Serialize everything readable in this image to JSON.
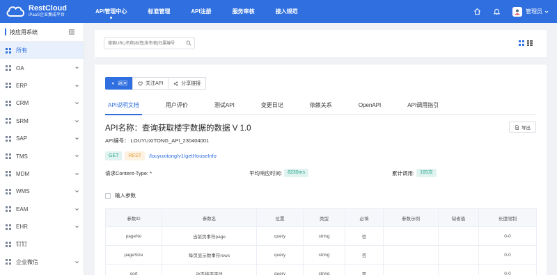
{
  "brand": {
    "name": "RestCloud",
    "subtitle": "iPaaS企业集成平台"
  },
  "nav": {
    "items": [
      {
        "label": "API管理中心",
        "active": true
      },
      {
        "label": "标准管理",
        "active": false
      },
      {
        "label": "API注册",
        "active": false
      },
      {
        "label": "服务审核",
        "active": false
      },
      {
        "label": "接入规范",
        "active": false
      }
    ]
  },
  "user": {
    "name": "管理员"
  },
  "sidebar": {
    "title": "按应用系统",
    "items": [
      {
        "label": "所有",
        "active": true,
        "expandable": false
      },
      {
        "label": "OA",
        "active": false,
        "expandable": true
      },
      {
        "label": "ERP",
        "active": false,
        "expandable": true
      },
      {
        "label": "CRM",
        "active": false,
        "expandable": true
      },
      {
        "label": "SRM",
        "active": false,
        "expandable": true
      },
      {
        "label": "SAP",
        "active": false,
        "expandable": true
      },
      {
        "label": "TMS",
        "active": false,
        "expandable": true
      },
      {
        "label": "MDM",
        "active": false,
        "expandable": true
      },
      {
        "label": "WMS",
        "active": false,
        "expandable": true
      },
      {
        "label": "EAM",
        "active": false,
        "expandable": true
      },
      {
        "label": "EHR",
        "active": false,
        "expandable": true
      },
      {
        "label": "钉钉",
        "active": false,
        "expandable": false
      },
      {
        "label": "企业微信",
        "active": false,
        "expandable": true
      }
    ]
  },
  "search": {
    "placeholder": "搜索URL|名称|标签|发布者|归属编号"
  },
  "actions": {
    "back": "返回",
    "follow": "关注API",
    "share": "分享链接"
  },
  "tabs": [
    {
      "label": "API说明文档",
      "active": true
    },
    {
      "label": "用户评价",
      "active": false
    },
    {
      "label": "测试API",
      "active": false
    },
    {
      "label": "变更日记",
      "active": false
    },
    {
      "label": "依赖关系",
      "active": false
    },
    {
      "label": "OpenAPI",
      "active": false
    },
    {
      "label": "API调用指引",
      "active": false
    }
  ],
  "api": {
    "title": "API名称：查询获取楼宇数据的数据 V 1.0",
    "export_label": "导出",
    "id_line": "API编号：  LOUYUXITONG_API_230404001",
    "method": "GET",
    "style": "REST",
    "path": "/louyuxitong/v1/getHouseInfo",
    "content_type_label": "请求Content-Type:  *",
    "avg_time_label": "平均响应时间:",
    "avg_time_value": "8230ms",
    "calls_label": "累计调用:",
    "calls_value": "165次"
  },
  "params": {
    "section_label": "输入参数",
    "columns": [
      "参数ID",
      "参数名",
      "位置",
      "类型",
      "必填",
      "参数示例",
      "缺省值",
      "长度限制"
    ],
    "rows": [
      [
        "pageNo",
        "当前页事符page",
        "query",
        "string",
        "否",
        "",
        "",
        "0-0"
      ],
      [
        "pageSize",
        "每页显示数事符rows",
        "query",
        "string",
        "否",
        "",
        "",
        "0-0"
      ],
      [
        "sort",
        "动态排序字段",
        "query",
        "string",
        "否",
        "",
        "",
        "0-0"
      ]
    ]
  },
  "colors": {
    "primary": "#2f6fe0",
    "success": "#23a38c",
    "warning": "#e6a23c"
  }
}
